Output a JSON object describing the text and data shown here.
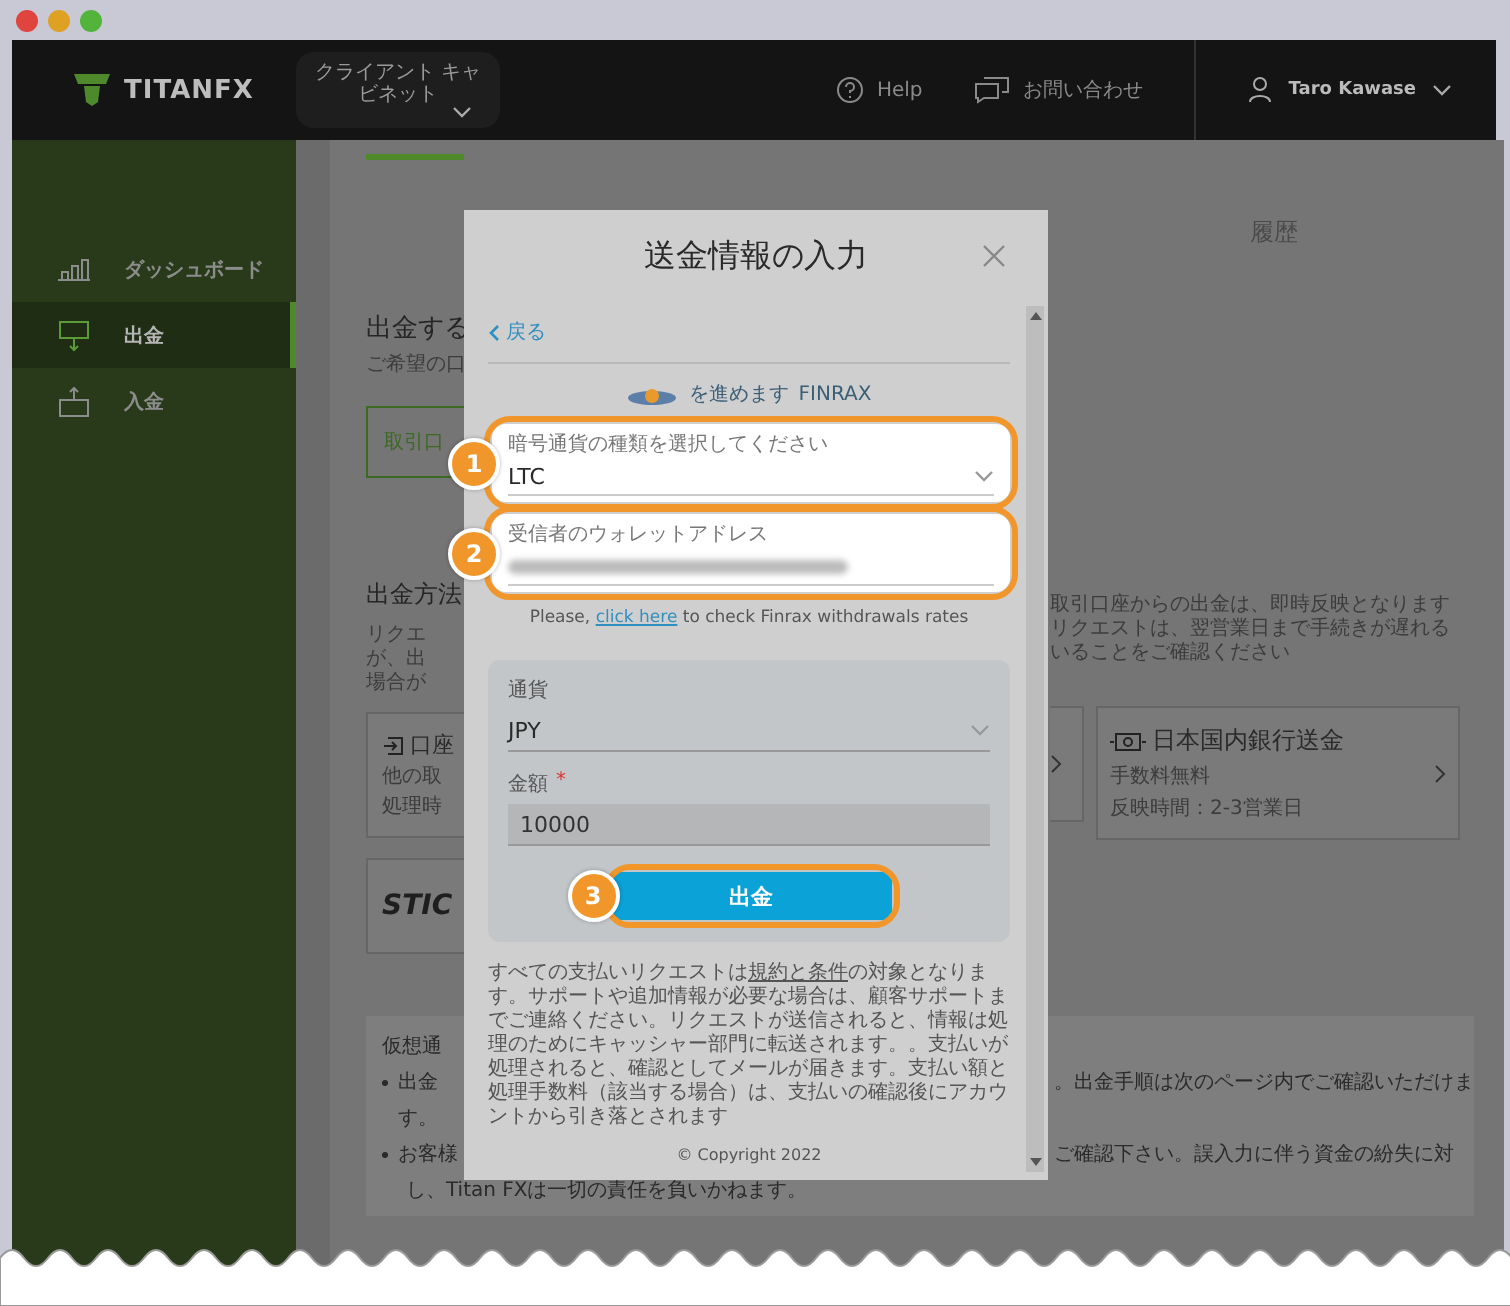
{
  "header": {
    "logo": "TITANFX",
    "cabinet_menu": "クライアント キャビネット",
    "help": "Help",
    "contact": "お問い合わせ",
    "user": "Taro Kawase"
  },
  "sidebar": {
    "items": [
      {
        "label": "ダッシュボード",
        "kind": "chart",
        "selected": false
      },
      {
        "label": "出金",
        "kind": "withdraw",
        "selected": true
      },
      {
        "label": "入金",
        "kind": "deposit",
        "selected": false
      }
    ]
  },
  "page": {
    "history_tab": "履歴",
    "section_title": "出金する",
    "section_hint": "ご希望の口",
    "account_option": "取引口",
    "methods_title": "出金方法",
    "methods_note_left": [
      "リクエ",
      "が、出",
      "場合が"
    ],
    "methods_note_right": [
      "取引口座からの出金は、即時反映となります",
      "リクエストは、翌営業日まで手続きが遅れる",
      "いることをご確認ください"
    ],
    "method_cards": [
      {
        "kind": "transfer",
        "title": "口座",
        "lines": [
          "他の取",
          "処理時"
        ]
      },
      {
        "kind": "brand",
        "title": "STIC"
      },
      {
        "kind": "edge"
      },
      {
        "kind": "bank",
        "title": "日本国内銀行送金",
        "lines": [
          "手数料無料",
          "反映時間：2-3営業日"
        ]
      }
    ],
    "info": {
      "title": "仮想通",
      "bullets": [
        {
          "left": "出金",
          "right": "。出金手順は次のページ内でご確認いただけま",
          "next_left": "す。"
        },
        {
          "left": "お客様",
          "right": "ご確認下さい。誤入力に伴う資金の紛失に対",
          "next_full": "し、Titan FXは一切の責任を負いかねます。"
        }
      ]
    }
  },
  "modal": {
    "title": "送金情報の入力",
    "back": "戻る",
    "provider_text": "を進めます",
    "provider_name": "FINRAX",
    "fields": [
      {
        "kind": "select",
        "label": "暗号通貨の種類を選択してください",
        "value": "LTC",
        "badge": "1",
        "highlighted": true
      },
      {
        "kind": "text",
        "label": "受信者のウォレットアドレス",
        "blurred": true,
        "badge": "2",
        "highlighted": true
      }
    ],
    "note": {
      "before": "Please, ",
      "link": "click here",
      "after": " to check Finrax withdrawals rates"
    },
    "currency": {
      "label": "通貨",
      "value": "JPY"
    },
    "amount": {
      "label": "金額",
      "required_mark": "*",
      "value": "10000"
    },
    "submit": {
      "label": "出金",
      "badge": "3",
      "highlighted": true
    },
    "terms": {
      "before": "すべての支払いリクエストは",
      "link": "規約と条件",
      "after": "の対象となります。サポートや追加情報が必要な場合は、顧客サポートまでご連絡ください。リクエストが送信されると、情報は処理のためにキャッシャー部門に転送されます。。支払いが処理されると、確認としてメールが届きます。支払い額と処理手数料（該当する場合）は、支払いの確認後にアカウントから引き落とされます"
    },
    "copyright": "© Copyright 2022"
  }
}
